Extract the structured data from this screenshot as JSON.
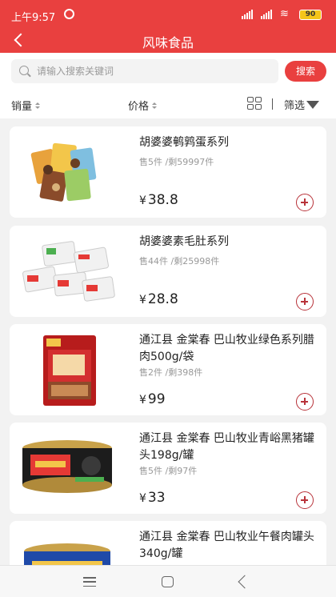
{
  "status_bar": {
    "time": "上午9:57",
    "battery": "90",
    "icons": [
      "alarm-icon",
      "signal-icon",
      "signal-icon",
      "wifi-icon",
      "battery-icon"
    ]
  },
  "title_bar": {
    "title": "风味食品",
    "back_icon": "chevron-left-icon"
  },
  "search": {
    "placeholder": "请输入搜索关键词",
    "value": "",
    "button_label": "搜索",
    "icon": "search-icon"
  },
  "sort_bar": {
    "sales_label": "销量",
    "price_label": "价格",
    "layout_icon": "grid-view-icon",
    "separator": "|",
    "filter_label": "筛选",
    "filter_icon": "funnel-icon"
  },
  "products": [
    {
      "name": "胡婆婆鹌鹑蛋系列",
      "sold": "售5件",
      "stock": "/剩59997件",
      "currency": "¥",
      "price": "38.8"
    },
    {
      "name": "胡婆婆素毛肚系列",
      "sold": "售44件",
      "stock": "/剩25998件",
      "currency": "¥",
      "price": "28.8"
    },
    {
      "name": "通江县 金棠春 巴山牧业绿色系列腊肉500g/袋",
      "sold": "售2件",
      "stock": "/剩398件",
      "currency": "¥",
      "price": "99"
    },
    {
      "name": "通江县 金棠春 巴山牧业青峪黑猪罐头198g/罐",
      "sold": "售5件",
      "stock": "/剩97件",
      "currency": "¥",
      "price": "33"
    },
    {
      "name": "通江县 金棠春 巴山牧业午餐肉罐头340g/罐",
      "sold": "",
      "stock": "",
      "currency": "",
      "price": ""
    }
  ],
  "nav_bar": {
    "icons": [
      "menu-icon",
      "home-icon",
      "back-icon"
    ]
  },
  "colors": {
    "brand_red": "#e9403f",
    "add_button": "#b8333a",
    "background": "#f2f2f2"
  }
}
